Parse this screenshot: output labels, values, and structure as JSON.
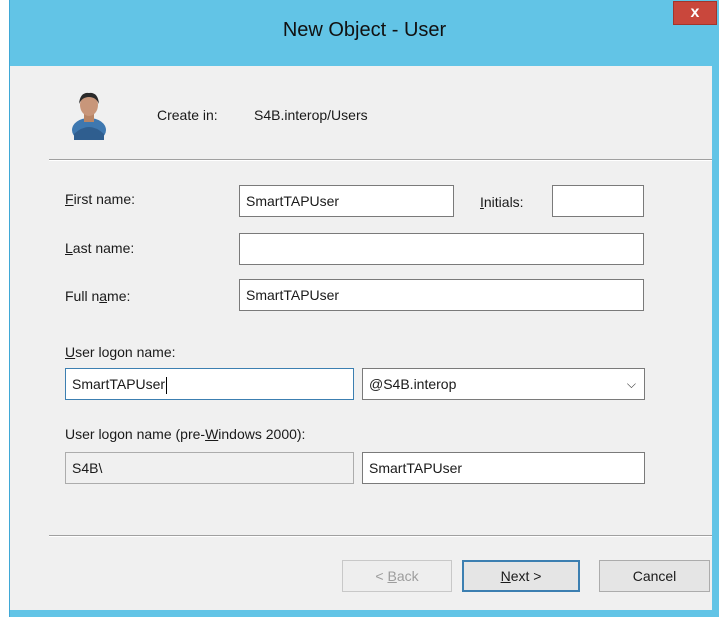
{
  "window": {
    "title": "New Object - User",
    "close_glyph": "x"
  },
  "header": {
    "icon": "user-icon",
    "create_in_label": "Create in:",
    "create_in_value": "S4B.interop/Users"
  },
  "form": {
    "first_name": {
      "label": "First name:",
      "accel": "F",
      "rest": "irst name:",
      "value": "SmartTAPUser"
    },
    "initials": {
      "label": "Initials:",
      "accel": "I",
      "rest": "nitials:",
      "value": ""
    },
    "last_name": {
      "label": "Last name:",
      "accel": "L",
      "rest": "ast name:",
      "value": ""
    },
    "full_name": {
      "label": "Full name:",
      "pre": "Full n",
      "accel": "a",
      "rest": "me:",
      "value": "SmartTAPUser"
    },
    "logon_name": {
      "label": "User logon name:",
      "accel": "U",
      "rest": "ser logon name:",
      "value": "SmartTAPUser"
    },
    "upn_suffix": {
      "selected": "@S4B.interop"
    },
    "pre_win2000": {
      "label": "User logon name (pre-Windows 2000):",
      "pre": "User logon name (pre-",
      "accel": "W",
      "rest": "indows 2000):",
      "domain": "S4B\\",
      "value": "SmartTAPUser"
    }
  },
  "buttons": {
    "back": {
      "label": "< Back",
      "pre": "< ",
      "accel": "B",
      "rest": "ack"
    },
    "next": {
      "label": "Next >",
      "accel": "N",
      "rest": "ext >"
    },
    "cancel": {
      "label": "Cancel"
    }
  },
  "colors": {
    "titlebar": "#62c4e6",
    "close": "#c9473c",
    "dialog_bg": "#f0f0f0",
    "default_button_border": "#3c7fb1"
  }
}
